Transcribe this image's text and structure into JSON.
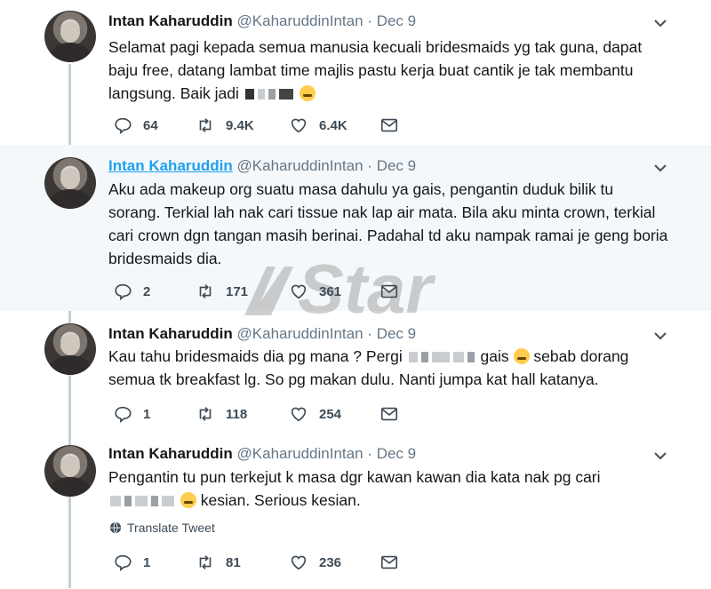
{
  "tweets": [
    {
      "name": "Intan Kaharuddin",
      "handle": "@KaharuddinIntan",
      "separator": "·",
      "date": "Dec 9",
      "line1": "Selamat pagi kepada semua manusia kecuali bridesmaids yg tak guna, dapat",
      "line2": "baju free, datang lambat time majlis pastu kerja buat cantik je tak membantu",
      "line3": "langsung. Baik jadi",
      "replies": "64",
      "retweets": "9.4K",
      "likes": "6.4K"
    },
    {
      "name": "Intan Kaharuddin",
      "handle": "@KaharuddinIntan",
      "separator": "·",
      "date": "Dec 9",
      "line1": "Aku ada makeup org suatu masa dahulu ya gais, pengantin duduk bilik tu",
      "line2": "sorang. Terkial lah nak cari tissue nak lap air mata. Bila aku minta crown, terkial",
      "line3": "cari crown dgn tangan masih berinai. Padahal td aku nampak ramai je geng boria",
      "line4": "bridesmaids dia.",
      "replies": "2",
      "retweets": "171",
      "likes": "361"
    },
    {
      "name": "Intan Kaharuddin",
      "handle": "@KaharuddinIntan",
      "separator": "·",
      "date": "Dec 9",
      "line1a": "Kau tahu bridesmaids dia pg mana ? Pergi",
      "line1b": "gais",
      "line1c": "sebab dorang",
      "line2": "semua tk breakfast lg. So pg makan dulu. Nanti jumpa kat hall katanya.",
      "replies": "1",
      "retweets": "118",
      "likes": "254"
    },
    {
      "name": "Intan Kaharuddin",
      "handle": "@KaharuddinIntan",
      "separator": "·",
      "date": "Dec 9",
      "line1": "Pengantin tu pun terkejut k masa dgr kawan kawan dia kata nak pg cari",
      "line2": "kesian. Serious kesian.",
      "translate": "Translate Tweet",
      "replies": "1",
      "retweets": "81",
      "likes": "236"
    }
  ],
  "watermark": "Star",
  "colors": {
    "link": "#1da1f2",
    "muted": "#657786",
    "thread_line": "#c4cfd6",
    "highlight_bg": "#f5f8fa"
  },
  "icons": [
    "reply-icon",
    "retweet-icon",
    "like-icon",
    "message-icon",
    "chevron-down-icon",
    "globe-icon"
  ]
}
